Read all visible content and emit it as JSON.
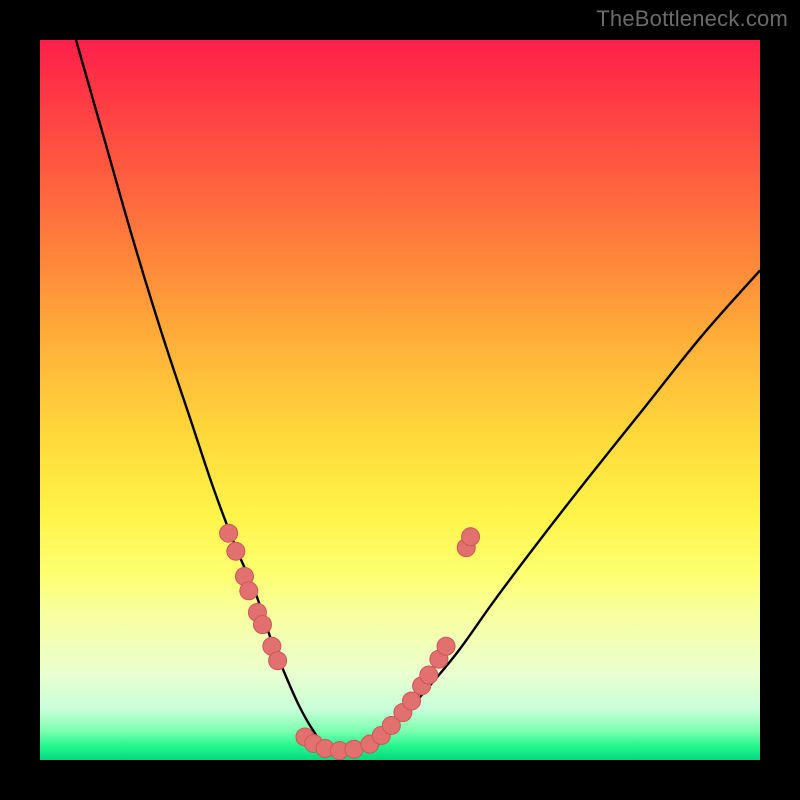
{
  "watermark": "TheBottleneck.com",
  "colors": {
    "page_bg": "#000000",
    "curve_stroke": "#000000",
    "marker_fill": "#e2706f",
    "marker_stroke": "#c95857"
  },
  "chart_data": {
    "type": "line",
    "title": "",
    "xlabel": "",
    "ylabel": "",
    "xlim": [
      0,
      100
    ],
    "ylim": [
      0,
      100
    ],
    "grid": false,
    "legend": false,
    "note": "Axis values are not labeled in the source image; x and y are normalized 0..100 proportional to the visible plot area (y = 0 at bottom / green, y = 100 at top / red). Curve minimum is at roughly x ≈ 40, y ≈ 1.",
    "series": [
      {
        "name": "bottleneck-curve",
        "x": [
          5.0,
          9.0,
          13.0,
          17.0,
          21.0,
          24.0,
          27.0,
          30.0,
          32.0,
          34.0,
          36.0,
          38.0,
          40.0,
          43.0,
          46.0,
          49.0,
          53.0,
          58.0,
          63.0,
          69.0,
          76.0,
          84.0,
          92.0,
          100.0
        ],
        "y": [
          100.0,
          86.0,
          72.0,
          59.0,
          47.0,
          38.0,
          30.0,
          23.0,
          17.0,
          12.0,
          7.5,
          4.0,
          1.5,
          1.0,
          2.0,
          4.5,
          9.0,
          15.0,
          22.0,
          30.0,
          39.0,
          49.0,
          59.0,
          68.0
        ]
      }
    ],
    "markers": {
      "name": "salmon-markers",
      "points": [
        {
          "x": 26.2,
          "y": 31.5
        },
        {
          "x": 27.2,
          "y": 29.0
        },
        {
          "x": 28.4,
          "y": 25.5
        },
        {
          "x": 29.0,
          "y": 23.5
        },
        {
          "x": 30.2,
          "y": 20.5
        },
        {
          "x": 30.9,
          "y": 18.8
        },
        {
          "x": 32.2,
          "y": 15.8
        },
        {
          "x": 33.0,
          "y": 13.8
        },
        {
          "x": 36.8,
          "y": 3.2
        },
        {
          "x": 38.0,
          "y": 2.3
        },
        {
          "x": 39.6,
          "y": 1.6
        },
        {
          "x": 41.6,
          "y": 1.3
        },
        {
          "x": 43.6,
          "y": 1.5
        },
        {
          "x": 45.8,
          "y": 2.2
        },
        {
          "x": 47.4,
          "y": 3.4
        },
        {
          "x": 48.8,
          "y": 4.8
        },
        {
          "x": 50.4,
          "y": 6.6
        },
        {
          "x": 51.6,
          "y": 8.2
        },
        {
          "x": 53.0,
          "y": 10.3
        },
        {
          "x": 54.0,
          "y": 11.8
        },
        {
          "x": 55.4,
          "y": 14.0
        },
        {
          "x": 56.4,
          "y": 15.8
        },
        {
          "x": 59.2,
          "y": 29.5
        },
        {
          "x": 59.8,
          "y": 31.0
        }
      ]
    }
  }
}
